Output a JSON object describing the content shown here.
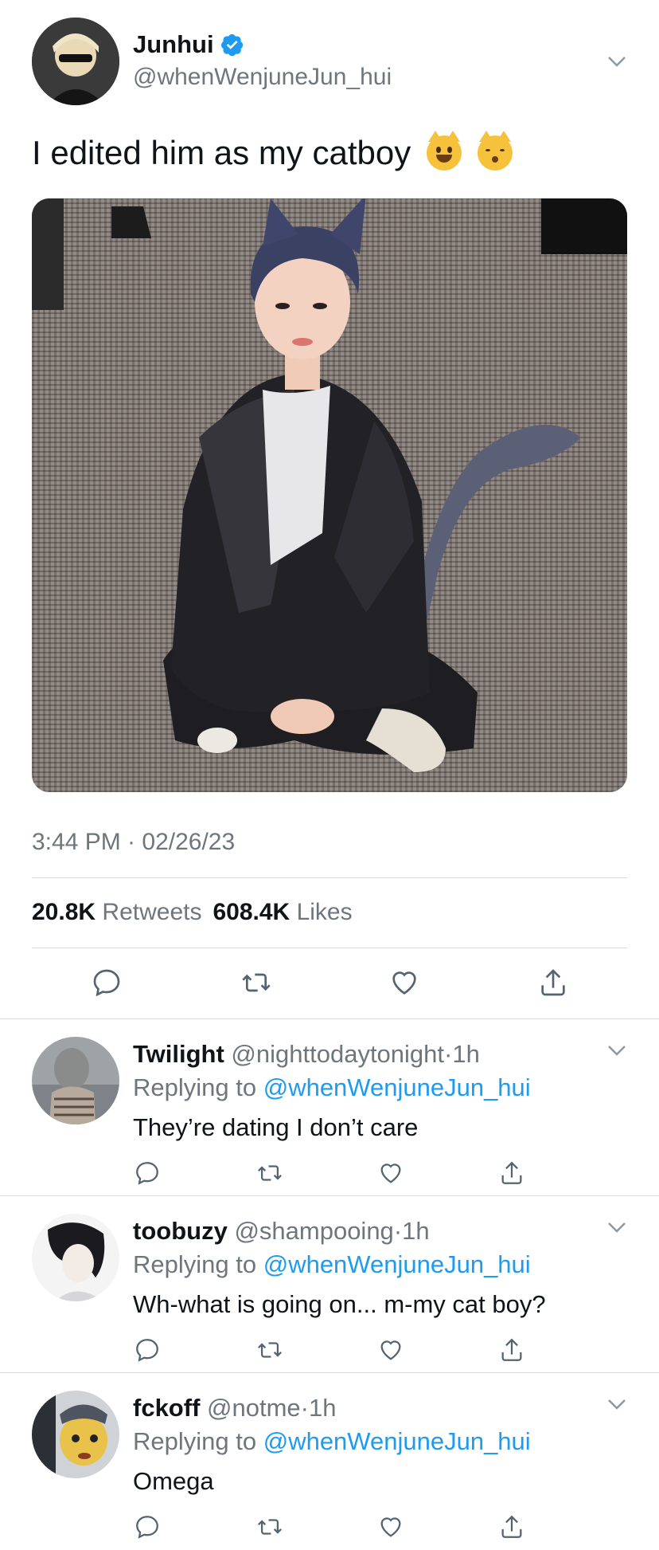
{
  "tweet": {
    "author_name": "Junhui",
    "author_handle": "@whenWenjuneJun_hui",
    "text": "I edited him as my catboy",
    "emojis": [
      "grinning-cat-emoji",
      "kissing-cat-emoji"
    ],
    "timestamp": "3:44 PM · 02/26/23",
    "retweets_count": "20.8K",
    "retweets_label": "Retweets",
    "likes_count": "608.4K",
    "likes_label": "Likes"
  },
  "icons": {
    "verified": "verified-badge-icon",
    "reply": "reply-icon",
    "retweet": "retweet-icon",
    "like": "heart-icon",
    "share": "share-icon",
    "more": "chevron-down-icon"
  },
  "colors": {
    "accent": "#1d9bf0",
    "muted_text": "#6e767d",
    "primary_text": "#0f1419",
    "divider": "#d9dde0"
  },
  "replies": [
    {
      "name": "Twilight",
      "handle": "@nighttodaytonight",
      "time": "1h",
      "replying_label": "Replying to",
      "mention": "@whenWenjuneJun_hui",
      "text": "They’re dating I don’t care"
    },
    {
      "name": "toobuzy",
      "handle": "@shampooing",
      "time": "1h",
      "replying_label": "Replying to",
      "mention": "@whenWenjuneJun_hui",
      "text": "Wh-what is going on... m-my cat boy?"
    },
    {
      "name": "fckoff",
      "handle": "@notme",
      "time": "1h",
      "replying_label": "Replying to",
      "mention": "@whenWenjuneJun_hui",
      "text": "Omega"
    }
  ]
}
